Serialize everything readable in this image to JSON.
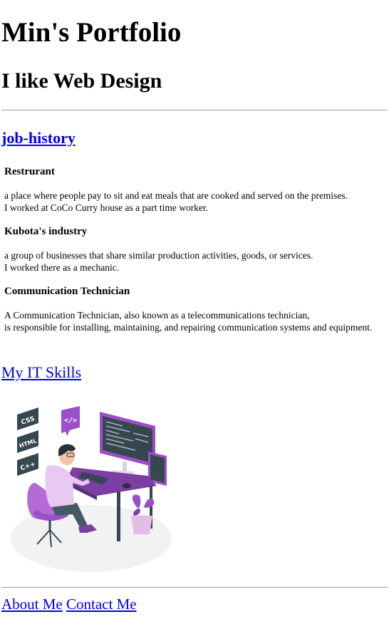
{
  "header": {
    "title": "Min's Portfolio",
    "subtitle": "I like Web Design"
  },
  "sections": {
    "job_history_link": "job-history",
    "skills_link": "My IT Skills"
  },
  "jobs": [
    {
      "title": "Restrurant",
      "line1": "a place where people pay to sit and eat meals that are cooked and served on the premises.",
      "line2": "I worked at CoCo Curry house as a part time worker."
    },
    {
      "title": "Kubota's industry",
      "line1": "a group of businesses that share similar production activities, goods, or services.",
      "line2": "I worked there as a mechanic."
    },
    {
      "title": "Communication Technician",
      "line1": "A Communication Technician, also known as a telecommunications technician,",
      "line2": "is responsible for installing, maintaining, and repairing communication systems and equipment."
    }
  ],
  "illustration": {
    "badges": [
      "CSS",
      "HTML",
      "C++"
    ],
    "code_badge": "</>"
  },
  "footer": {
    "about": "About Me",
    "contact": "Contact Me"
  },
  "colors": {
    "link": "#0000ee",
    "accent_purple": "#9b4fc9",
    "dark_slate": "#37474f"
  }
}
